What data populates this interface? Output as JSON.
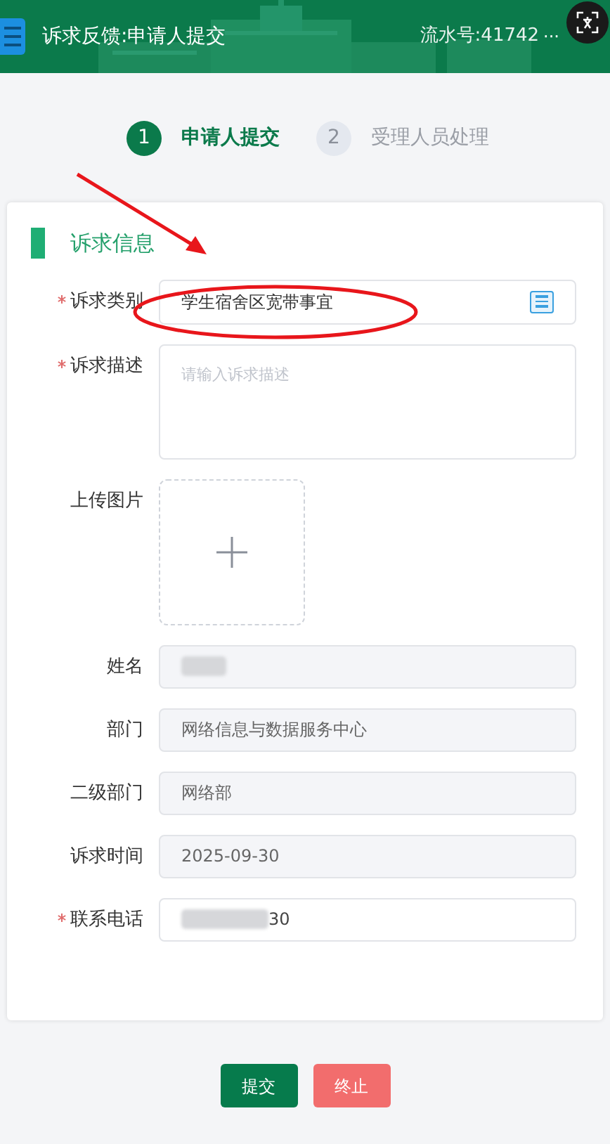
{
  "header": {
    "title": "诉求反馈:申请人提交",
    "serial": "流水号:41742",
    "more": "···"
  },
  "steps": [
    {
      "number": "1",
      "label": "申请人提交",
      "selected": true
    },
    {
      "number": "2",
      "label": "受理人员处理",
      "selected": false
    }
  ],
  "section": {
    "title": "诉求信息"
  },
  "fields": [
    {
      "kind": "select",
      "label": "诉求类别",
      "required": true,
      "value": "学生宿舍区宽带事宜"
    },
    {
      "kind": "textarea",
      "label": "诉求描述",
      "required": true,
      "placeholder": "请输入诉求描述"
    },
    {
      "kind": "upload",
      "label": "上传图片",
      "required": false
    },
    {
      "kind": "text",
      "label": "姓名",
      "required": false,
      "disabled": true,
      "redacted": true
    },
    {
      "kind": "text",
      "label": "部门",
      "required": false,
      "disabled": true,
      "value": "网络信息与数据服务中心"
    },
    {
      "kind": "text",
      "label": "二级部门",
      "required": false,
      "disabled": true,
      "value": "网络部"
    },
    {
      "kind": "text",
      "label": "诉求时间",
      "required": false,
      "disabled": true,
      "value": "2025-09-30"
    },
    {
      "kind": "text",
      "label": "联系电话",
      "required": true,
      "disabled": false,
      "redacted": true,
      "value": "30"
    }
  ],
  "buttons": [
    {
      "kind": "primary",
      "label": "提交"
    },
    {
      "kind": "danger",
      "label": "终止"
    }
  ]
}
